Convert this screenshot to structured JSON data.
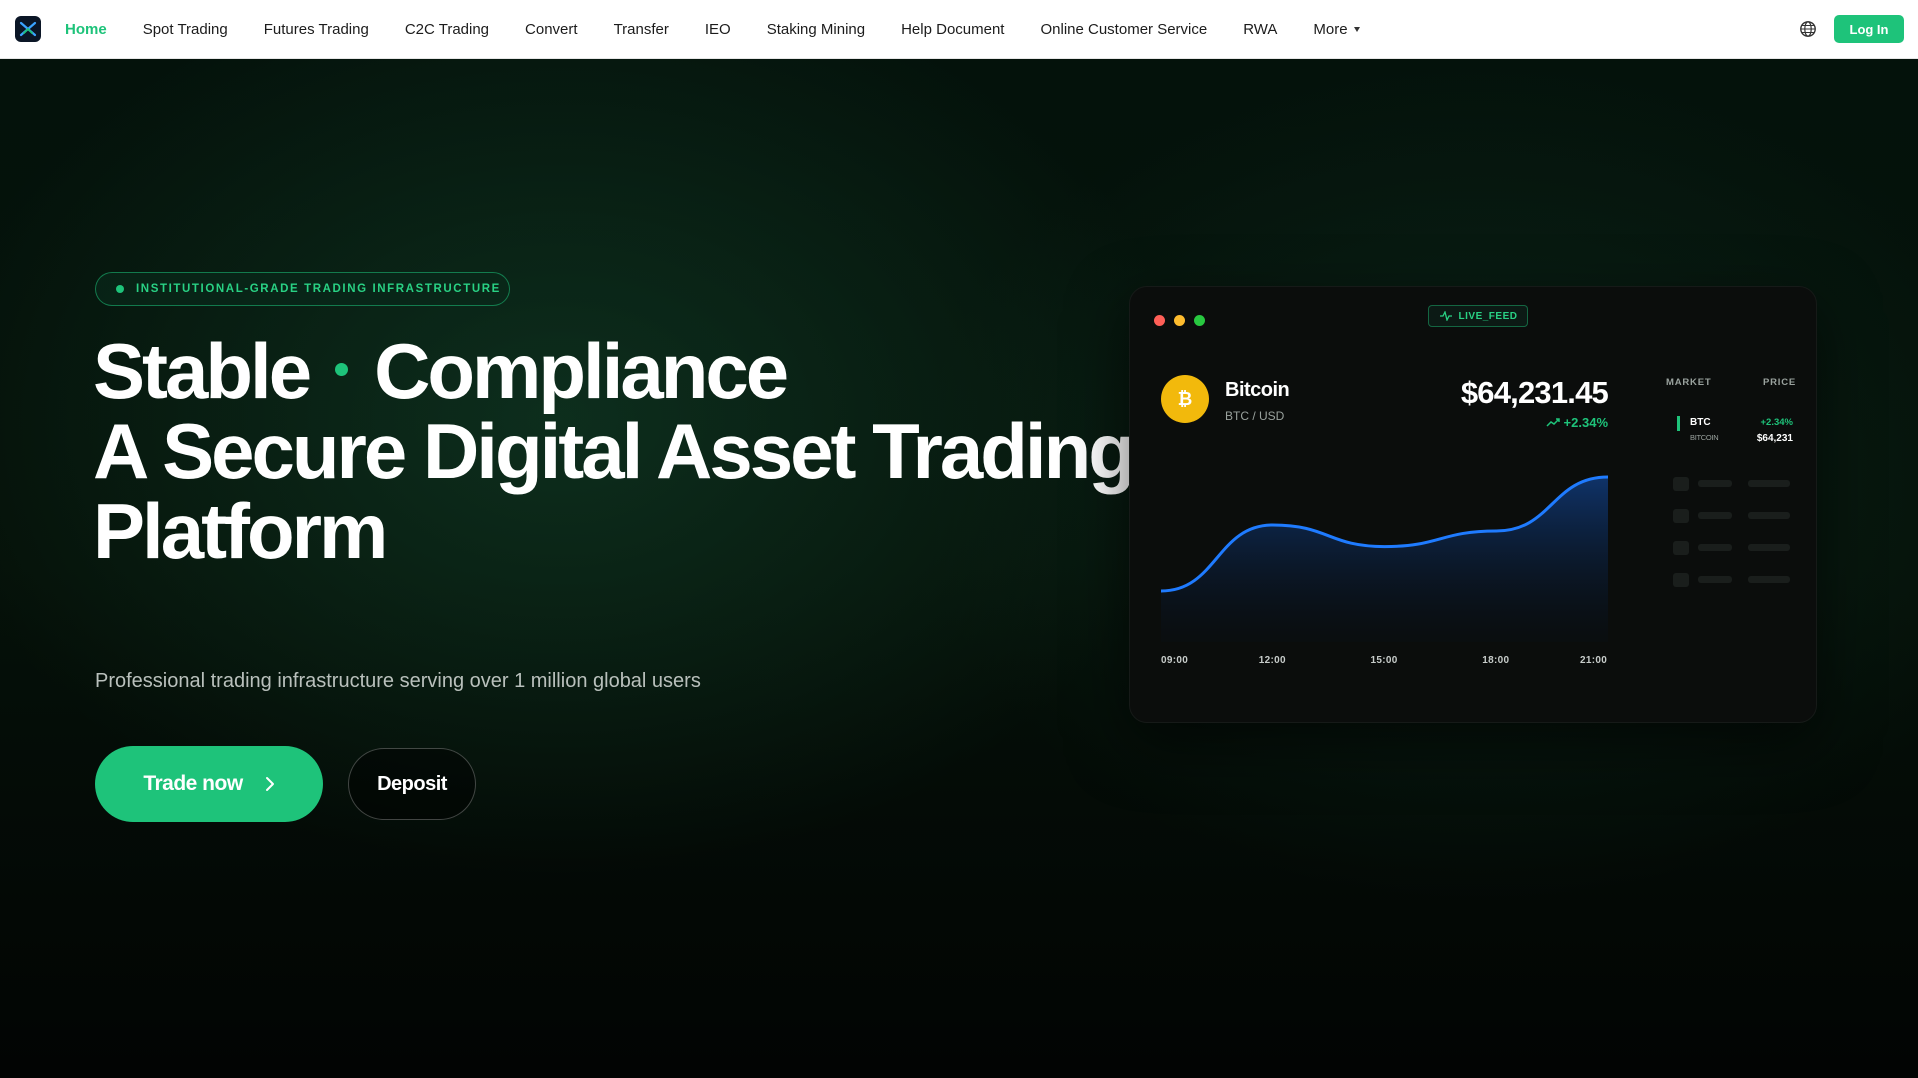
{
  "nav": {
    "items": [
      {
        "label": "Home",
        "active": true
      },
      {
        "label": "Spot Trading"
      },
      {
        "label": "Futures Trading"
      },
      {
        "label": "C2C Trading"
      },
      {
        "label": "Convert"
      },
      {
        "label": "Transfer"
      },
      {
        "label": "IEO"
      },
      {
        "label": "Staking Mining"
      },
      {
        "label": "Help Document"
      },
      {
        "label": "Online Customer Service"
      },
      {
        "label": "RWA"
      }
    ],
    "more_label": "More",
    "login_label": "Log In",
    "globe_icon": "globe-icon",
    "accent": "#1ec37a"
  },
  "hero": {
    "badge": "INSTITUTIONAL-GRADE TRADING INFRASTRUCTURE",
    "headline_a": "Stable",
    "headline_b": "Compliance",
    "headline_line2": "A Secure Digital Asset Trading",
    "headline_line3": "Platform",
    "subtitle": "Professional trading infrastructure serving over 1 million global users",
    "trade_button": "Trade now",
    "deposit_button": "Deposit"
  },
  "card": {
    "live_label": "LIVE_FEED",
    "coin_symbol_glyph": "₿",
    "coin_name": "Bitcoin",
    "coin_pair": "BTC / USD",
    "price": "$64,231.45",
    "change": "+2.34%",
    "market_header": "MARKET",
    "price_header": "PRICE",
    "market_row": {
      "symbol": "BTC",
      "name": "BITCOIN",
      "change": "+2.34%",
      "price": "$64,231"
    },
    "colors": {
      "line": "#1f7bff",
      "up": "#1ec37a",
      "coin": "#f2b90c"
    }
  },
  "chart_data": {
    "type": "area",
    "x": [
      "09:00",
      "12:00",
      "15:00",
      "18:00",
      "21:00"
    ],
    "series": [
      {
        "values": [
          0.05,
          0.6,
          0.42,
          0.55,
          1.0
        ]
      }
    ],
    "ylim": [
      0,
      1
    ],
    "grid": false
  }
}
